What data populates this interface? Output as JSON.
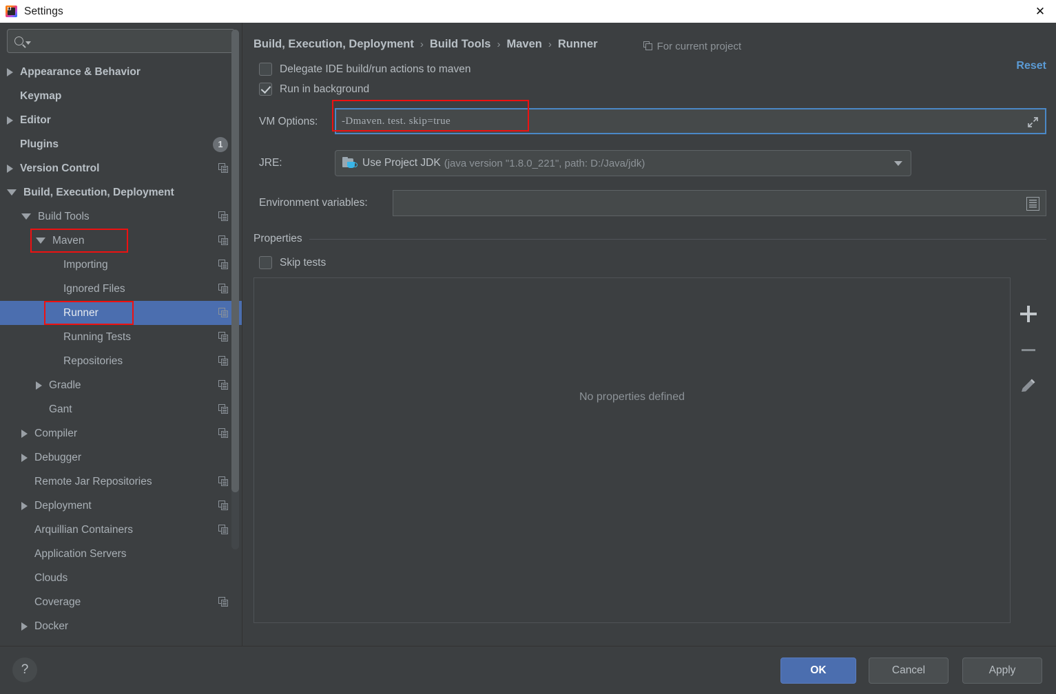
{
  "window": {
    "title": "Settings",
    "app_icon": "intellij-idea-icon",
    "close_icon": "close-icon"
  },
  "sidebar": {
    "search": {
      "placeholder": "",
      "value": "",
      "icon": "search-icon"
    },
    "items": [
      {
        "label": "Appearance & Behavior",
        "indent": 0,
        "arrow": "right",
        "bold": true,
        "copy": false,
        "badge": "",
        "selected": false
      },
      {
        "label": "Keymap",
        "indent": 0,
        "arrow": "none",
        "bold": true,
        "copy": false,
        "badge": "",
        "selected": false
      },
      {
        "label": "Editor",
        "indent": 0,
        "arrow": "right",
        "bold": true,
        "copy": false,
        "badge": "",
        "selected": false
      },
      {
        "label": "Plugins",
        "indent": 0,
        "arrow": "none",
        "bold": true,
        "copy": false,
        "badge": "1",
        "selected": false
      },
      {
        "label": "Version Control",
        "indent": 0,
        "arrow": "right",
        "bold": true,
        "copy": true,
        "badge": "",
        "selected": false
      },
      {
        "label": "Build, Execution, Deployment",
        "indent": 0,
        "arrow": "down",
        "bold": true,
        "copy": false,
        "badge": "",
        "selected": false
      },
      {
        "label": "Build Tools",
        "indent": 1,
        "arrow": "down",
        "bold": false,
        "copy": true,
        "badge": "",
        "selected": false
      },
      {
        "label": "Maven",
        "indent": 2,
        "arrow": "down",
        "bold": false,
        "copy": true,
        "badge": "",
        "selected": false
      },
      {
        "label": "Importing",
        "indent": 3,
        "arrow": "none",
        "bold": false,
        "copy": true,
        "badge": "",
        "selected": false
      },
      {
        "label": "Ignored Files",
        "indent": 3,
        "arrow": "none",
        "bold": false,
        "copy": true,
        "badge": "",
        "selected": false
      },
      {
        "label": "Runner",
        "indent": 3,
        "arrow": "none",
        "bold": false,
        "copy": true,
        "badge": "",
        "selected": true
      },
      {
        "label": "Running Tests",
        "indent": 3,
        "arrow": "none",
        "bold": false,
        "copy": true,
        "badge": "",
        "selected": false
      },
      {
        "label": "Repositories",
        "indent": 3,
        "arrow": "none",
        "bold": false,
        "copy": true,
        "badge": "",
        "selected": false
      },
      {
        "label": "Gradle",
        "indent": 2,
        "arrow": "right",
        "bold": false,
        "copy": true,
        "badge": "",
        "selected": false
      },
      {
        "label": "Gant",
        "indent": 2,
        "arrow": "none",
        "bold": false,
        "copy": true,
        "badge": "",
        "selected": false
      },
      {
        "label": "Compiler",
        "indent": 1,
        "arrow": "right",
        "bold": false,
        "copy": true,
        "badge": "",
        "selected": false
      },
      {
        "label": "Debugger",
        "indent": 1,
        "arrow": "right",
        "bold": false,
        "copy": false,
        "badge": "",
        "selected": false
      },
      {
        "label": "Remote Jar Repositories",
        "indent": 1,
        "arrow": "none",
        "bold": false,
        "copy": true,
        "badge": "",
        "selected": false
      },
      {
        "label": "Deployment",
        "indent": 1,
        "arrow": "right",
        "bold": false,
        "copy": true,
        "badge": "",
        "selected": false
      },
      {
        "label": "Arquillian Containers",
        "indent": 1,
        "arrow": "none",
        "bold": false,
        "copy": true,
        "badge": "",
        "selected": false
      },
      {
        "label": "Application Servers",
        "indent": 1,
        "arrow": "none",
        "bold": false,
        "copy": false,
        "badge": "",
        "selected": false
      },
      {
        "label": "Clouds",
        "indent": 1,
        "arrow": "none",
        "bold": false,
        "copy": false,
        "badge": "",
        "selected": false
      },
      {
        "label": "Coverage",
        "indent": 1,
        "arrow": "none",
        "bold": false,
        "copy": true,
        "badge": "",
        "selected": false
      },
      {
        "label": "Docker",
        "indent": 1,
        "arrow": "right",
        "bold": false,
        "copy": false,
        "badge": "",
        "selected": false
      }
    ]
  },
  "header": {
    "breadcrumb": [
      "Build, Execution, Deployment",
      "Build Tools",
      "Maven",
      "Runner"
    ],
    "separator": "›",
    "scope_note": "For current project",
    "scope_icon": "copy-scope-icon",
    "reset_label": "Reset",
    "reset_color": "#5b9bd5"
  },
  "form": {
    "delegate": {
      "label": "Delegate IDE build/run actions to maven",
      "mnemonic": "D",
      "checked": false
    },
    "run_background": {
      "label": "Run in background",
      "mnemonic": "b",
      "checked": true
    },
    "vm_options": {
      "label": "VM Options:",
      "value": "-Dmaven. test. skip=true",
      "expand_icon": "expand-arrows-icon"
    },
    "jre": {
      "label": "JRE:",
      "value_main": "Use Project JDK",
      "value_detail": "(java version \"1.8.0_221\", path: D:/Java/jdk)",
      "icon": "jdk-folder-icon",
      "caret_icon": "chevron-down-icon"
    },
    "env_vars": {
      "label": "Environment variables:",
      "value": "",
      "browse_icon": "list-browse-icon"
    }
  },
  "properties": {
    "section_title": "Properties",
    "skip_tests": {
      "label": "Skip tests",
      "mnemonic": "t",
      "checked": false
    },
    "empty_message": "No properties defined",
    "toolbar": [
      {
        "name": "add-property-button",
        "icon": "plus-icon"
      },
      {
        "name": "remove-property-button",
        "icon": "minus-icon"
      },
      {
        "name": "edit-property-button",
        "icon": "pencil-icon"
      }
    ]
  },
  "footer": {
    "help_label": "?",
    "ok_label": "OK",
    "cancel_label": "Cancel",
    "apply_label": "Apply",
    "ok_color": "#4b6eaf"
  },
  "annotations": {
    "highlight_color": "#ee1111",
    "boxes": [
      "maven-tree-item",
      "runner-tree-item",
      "vm-options-field"
    ]
  }
}
